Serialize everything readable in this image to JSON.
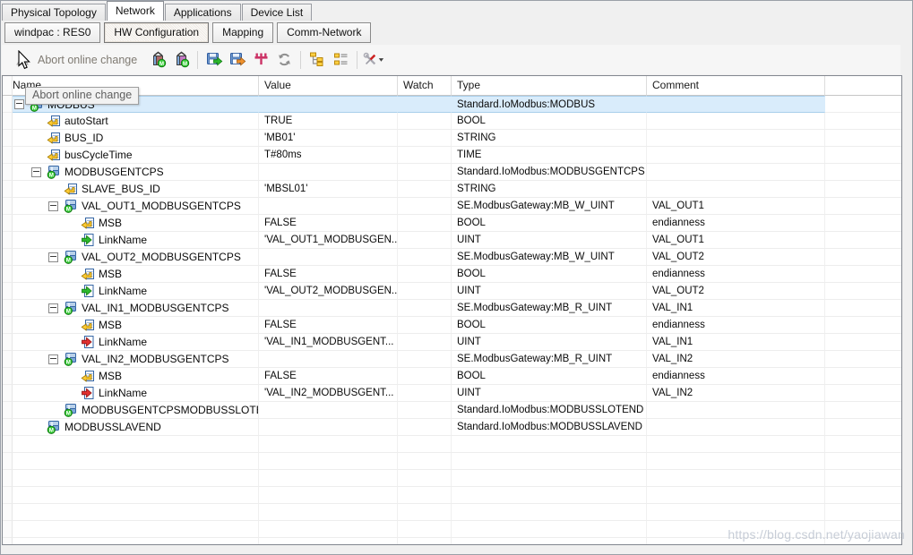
{
  "main_tabs": [
    {
      "label": "Physical Topology",
      "active": false
    },
    {
      "label": "Network",
      "active": true
    },
    {
      "label": "Applications",
      "active": false
    },
    {
      "label": "Device List",
      "active": false
    }
  ],
  "sub_tabs": [
    {
      "label": "windpac : RES0",
      "active": false
    },
    {
      "label": "HW Configuration",
      "active": true
    },
    {
      "label": "Mapping",
      "active": false
    },
    {
      "label": "Comm-Network",
      "active": false
    }
  ],
  "toolbar": {
    "abort_button": {
      "label": "Abort online change",
      "enabled": false
    },
    "tooltip": "Abort online change",
    "icon_groups": [
      [
        "insert-module-m-icon",
        "insert-slave-m-icon"
      ],
      [
        "export-icon",
        "import-icon",
        "fieldbus-icon",
        "refresh-icon"
      ],
      [
        "expand-tree-icon",
        "list-view-icon"
      ],
      [
        "tools-dropdown-icon"
      ]
    ]
  },
  "grid": {
    "columns": [
      "Name",
      "Value",
      "Watch",
      "Type",
      "Comment"
    ],
    "rows": [
      {
        "level": 0,
        "expanded": true,
        "icon": "module",
        "name": "MODBUS",
        "value": "",
        "watch": "",
        "type": "Standard.IoModbus:MODBUS",
        "comment": "",
        "selected": true
      },
      {
        "level": 1,
        "expanded": null,
        "icon": "param",
        "name": "autoStart",
        "value": "TRUE",
        "watch": "",
        "type": "BOOL",
        "comment": "",
        "selected": false
      },
      {
        "level": 1,
        "expanded": null,
        "icon": "param",
        "name": "BUS_ID",
        "value": "'MB01'",
        "watch": "",
        "type": "STRING",
        "comment": "",
        "selected": false
      },
      {
        "level": 1,
        "expanded": null,
        "icon": "param",
        "name": "busCycleTime",
        "value": "T#80ms",
        "watch": "",
        "type": "TIME",
        "comment": "",
        "selected": false
      },
      {
        "level": 1,
        "expanded": true,
        "icon": "module",
        "name": "MODBUSGENTCPS",
        "value": "",
        "watch": "",
        "type": "Standard.IoModbus:MODBUSGENTCPS",
        "comment": "",
        "selected": false
      },
      {
        "level": 2,
        "expanded": null,
        "icon": "param",
        "name": "SLAVE_BUS_ID",
        "value": "'MBSL01'",
        "watch": "",
        "type": "STRING",
        "comment": "",
        "selected": false
      },
      {
        "level": 2,
        "expanded": true,
        "icon": "module",
        "name": "VAL_OUT1_MODBUSGENTCPS",
        "value": "",
        "watch": "",
        "type": "SE.ModbusGateway:MB_W_UINT",
        "comment": "VAL_OUT1",
        "selected": false
      },
      {
        "level": 3,
        "expanded": null,
        "icon": "param",
        "name": "MSB",
        "value": "FALSE",
        "watch": "",
        "type": "BOOL",
        "comment": "endianness",
        "selected": false
      },
      {
        "level": 3,
        "expanded": null,
        "icon": "link-out",
        "name": "LinkName",
        "value": "'VAL_OUT1_MODBUSGEN...",
        "watch": "",
        "type": "UINT",
        "comment": "VAL_OUT1",
        "selected": false
      },
      {
        "level": 2,
        "expanded": true,
        "icon": "module",
        "name": "VAL_OUT2_MODBUSGENTCPS",
        "value": "",
        "watch": "",
        "type": "SE.ModbusGateway:MB_W_UINT",
        "comment": "VAL_OUT2",
        "selected": false
      },
      {
        "level": 3,
        "expanded": null,
        "icon": "param",
        "name": "MSB",
        "value": "FALSE",
        "watch": "",
        "type": "BOOL",
        "comment": "endianness",
        "selected": false
      },
      {
        "level": 3,
        "expanded": null,
        "icon": "link-out",
        "name": "LinkName",
        "value": "'VAL_OUT2_MODBUSGEN...",
        "watch": "",
        "type": "UINT",
        "comment": "VAL_OUT2",
        "selected": false
      },
      {
        "level": 2,
        "expanded": true,
        "icon": "module",
        "name": "VAL_IN1_MODBUSGENTCPS",
        "value": "",
        "watch": "",
        "type": "SE.ModbusGateway:MB_R_UINT",
        "comment": "VAL_IN1",
        "selected": false
      },
      {
        "level": 3,
        "expanded": null,
        "icon": "param",
        "name": "MSB",
        "value": "FALSE",
        "watch": "",
        "type": "BOOL",
        "comment": "endianness",
        "selected": false
      },
      {
        "level": 3,
        "expanded": null,
        "icon": "link-in",
        "name": "LinkName",
        "value": "'VAL_IN1_MODBUSGENT...",
        "watch": "",
        "type": "UINT",
        "comment": "VAL_IN1",
        "selected": false
      },
      {
        "level": 2,
        "expanded": true,
        "icon": "module",
        "name": "VAL_IN2_MODBUSGENTCPS",
        "value": "",
        "watch": "",
        "type": "SE.ModbusGateway:MB_R_UINT",
        "comment": "VAL_IN2",
        "selected": false
      },
      {
        "level": 3,
        "expanded": null,
        "icon": "param",
        "name": "MSB",
        "value": "FALSE",
        "watch": "",
        "type": "BOOL",
        "comment": "endianness",
        "selected": false
      },
      {
        "level": 3,
        "expanded": null,
        "icon": "link-in",
        "name": "LinkName",
        "value": "'VAL_IN2_MODBUSGENT...",
        "watch": "",
        "type": "UINT",
        "comment": "VAL_IN2",
        "selected": false
      },
      {
        "level": 2,
        "expanded": null,
        "icon": "module",
        "name": "MODBUSGENTCPSMODBUSSLOTEND",
        "value": "",
        "watch": "",
        "type": "Standard.IoModbus:MODBUSSLOTEND",
        "comment": "",
        "selected": false
      },
      {
        "level": 1,
        "expanded": null,
        "icon": "module",
        "name": "MODBUSSLAVEND",
        "value": "",
        "watch": "",
        "type": "Standard.IoModbus:MODBUSSLAVEND",
        "comment": "",
        "selected": false
      }
    ],
    "empty_row_count": 7
  },
  "watermark": "https://blog.csdn.net/yaojiawan",
  "colors": {
    "selection_bg": "#d9ecfb",
    "selection_border": "#a9cfeb",
    "module_blue": "#7da7d8",
    "badge_green": "#33cc33",
    "param_yellow": "#ffcc33",
    "link_out_green": "#2db82d",
    "link_in_red": "#e03030",
    "disabled_text": "#7f7a72"
  }
}
